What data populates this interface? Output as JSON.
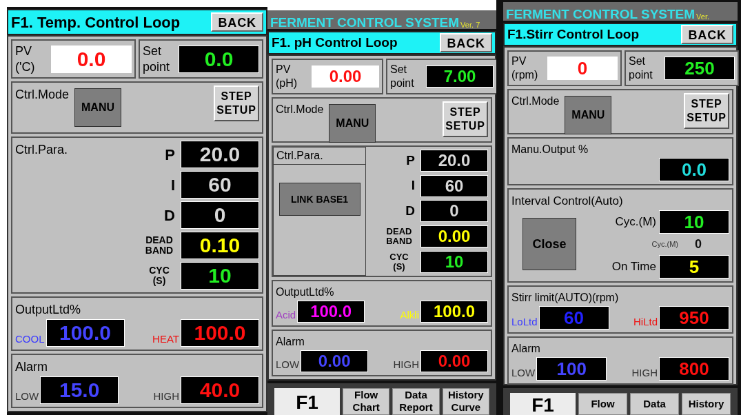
{
  "panels": [
    {
      "title": "F1. Temp. Control Loop",
      "back": "BACK",
      "pv": {
        "label": "PV ('C)",
        "value": "0.0"
      },
      "setpoint": {
        "label": "Set point",
        "value": "0.0"
      },
      "ctrl_mode": {
        "label": "Ctrl.Mode",
        "mode": "MANU",
        "step": "STEP SETUP"
      },
      "sections": [
        {
          "kind": "pid",
          "title": "Ctrl.Para.",
          "params": [
            {
              "kind": "gain",
              "label": "P",
              "value": "20.0",
              "color": "#d8d8d8"
            },
            {
              "kind": "gain",
              "label": "I",
              "value": "60",
              "color": "#d8d8d8"
            },
            {
              "kind": "gain",
              "label": "D",
              "value": "0",
              "color": "#d8d8d8"
            },
            {
              "kind": "setting",
              "label": "DEAD BAND",
              "value": "0.10",
              "color": "#ffff00"
            },
            {
              "kind": "setting",
              "label": "CYC (S)",
              "value": "10",
              "color": "#22ee22"
            }
          ]
        },
        {
          "kind": "pair",
          "title": "OutputLtd%",
          "items": [
            {
              "label": {
                "text": "COOL",
                "color": "#3b3bff"
              },
              "value": {
                "text": "100.0",
                "color": "#4444ff"
              }
            },
            {
              "label": {
                "text": "HEAT",
                "color": "#ee1111"
              },
              "value": {
                "text": "100.0",
                "color": "#ff1010"
              }
            }
          ]
        },
        {
          "kind": "pair",
          "title": "Alarm",
          "items": [
            {
              "label": {
                "text": "LOW",
                "color": "#333333"
              },
              "value": {
                "text": "15.0",
                "color": "#4444ff"
              }
            },
            {
              "label": {
                "text": "HIGH",
                "color": "#333333"
              },
              "value": {
                "text": "40.0",
                "color": "#ff1010"
              }
            }
          ]
        }
      ]
    },
    {
      "header": {
        "title": "FERMENT CONTROL SYSTEM",
        "version": "Ver. 7"
      },
      "title": "F1. pH Control Loop",
      "back": "BACK",
      "pv": {
        "label": "PV (pH)",
        "value": "0.00"
      },
      "setpoint": {
        "label": "Set point",
        "value": "7.00"
      },
      "ctrl_mode": {
        "label": "Ctrl.Mode",
        "mode": "MANU",
        "step": "STEP SETUP"
      },
      "sections": [
        {
          "kind": "pid",
          "title": "Ctrl.Para.",
          "link_button": "LINK BASE1",
          "params": [
            {
              "kind": "gain",
              "label": "P",
              "value": "20.0",
              "color": "#d8d8d8"
            },
            {
              "kind": "gain",
              "label": "I",
              "value": "60",
              "color": "#d8d8d8"
            },
            {
              "kind": "gain",
              "label": "D",
              "value": "0",
              "color": "#d8d8d8"
            },
            {
              "kind": "setting",
              "label": "DEAD BAND",
              "value": "0.00",
              "color": "#ffff00"
            },
            {
              "kind": "setting",
              "label": "CYC (S)",
              "value": "10",
              "color": "#22ee22"
            }
          ]
        },
        {
          "kind": "pair",
          "title": "OutputLtd%",
          "items": [
            {
              "label": {
                "text": "Acid",
                "color": "#a040c0"
              },
              "value": {
                "text": "100.0",
                "color": "#ff00ff"
              }
            },
            {
              "label": {
                "text": "Alkli",
                "color": "#ffff00"
              },
              "value": {
                "text": "100.0",
                "color": "#ffff00"
              }
            }
          ]
        },
        {
          "kind": "pair",
          "title": "Alarm",
          "items": [
            {
              "label": {
                "text": "LOW",
                "color": "#333333"
              },
              "value": {
                "text": "0.00",
                "color": "#4444ff"
              }
            },
            {
              "label": {
                "text": "HIGH",
                "color": "#333333"
              },
              "value": {
                "text": "0.00",
                "color": "#ff1010"
              }
            }
          ]
        }
      ],
      "tabs": [
        {
          "label": "F1",
          "selected": true
        },
        {
          "label": "Flow Chart",
          "selected": false
        },
        {
          "label": "Data Report",
          "selected": false
        },
        {
          "label": "History Curve",
          "selected": false
        }
      ]
    },
    {
      "header": {
        "title": "FERMENT CONTROL SYSTEM",
        "version": "Ver."
      },
      "title": "F1.Stirr Control Loop",
      "back": "BACK",
      "pv": {
        "label": "PV (rpm)",
        "value": "0"
      },
      "setpoint": {
        "label": "Set point",
        "value": "250"
      },
      "ctrl_mode": {
        "label": "Ctrl.Mode",
        "mode": "MANU",
        "step": "STEP SETUP"
      },
      "sections": [
        {
          "kind": "readout",
          "title": "Manu.Output %",
          "value": "0.0",
          "color": "#22dddd"
        },
        {
          "kind": "interval",
          "title": "Interval Control(Auto)",
          "button": "Close",
          "rows": [
            {
              "kind": "display",
              "label": "Cyc.(M)",
              "value": "10",
              "color": "#22ee22"
            },
            {
              "kind": "plain",
              "label": "Cyc.(M)",
              "value": "0",
              "color": "#111111"
            },
            {
              "kind": "display",
              "label": "On Time",
              "value": "5",
              "color": "#ffff00"
            }
          ]
        },
        {
          "kind": "pair",
          "title": "Stirr limit(AUTO)(rpm)",
          "items": [
            {
              "label": {
                "text": "LoLtd",
                "color": "#3b3bff"
              },
              "value": {
                "text": "60",
                "color": "#2222ff"
              }
            },
            {
              "label": {
                "text": "HiLtd",
                "color": "#ee1111"
              },
              "value": {
                "text": "950",
                "color": "#ff1010"
              }
            }
          ]
        },
        {
          "kind": "pair",
          "title": "Alarm",
          "items": [
            {
              "label": {
                "text": "LOW",
                "color": "#333333"
              },
              "value": {
                "text": "100",
                "color": "#4444ff"
              }
            },
            {
              "label": {
                "text": "HIGH",
                "color": "#333333"
              },
              "value": {
                "text": "800",
                "color": "#ff1010"
              }
            }
          ]
        }
      ],
      "tabs": [
        {
          "label": "F1",
          "selected": true
        },
        {
          "label": "Flow",
          "selected": false
        },
        {
          "label": "Data",
          "selected": false
        },
        {
          "label": "History",
          "selected": false
        }
      ]
    }
  ]
}
